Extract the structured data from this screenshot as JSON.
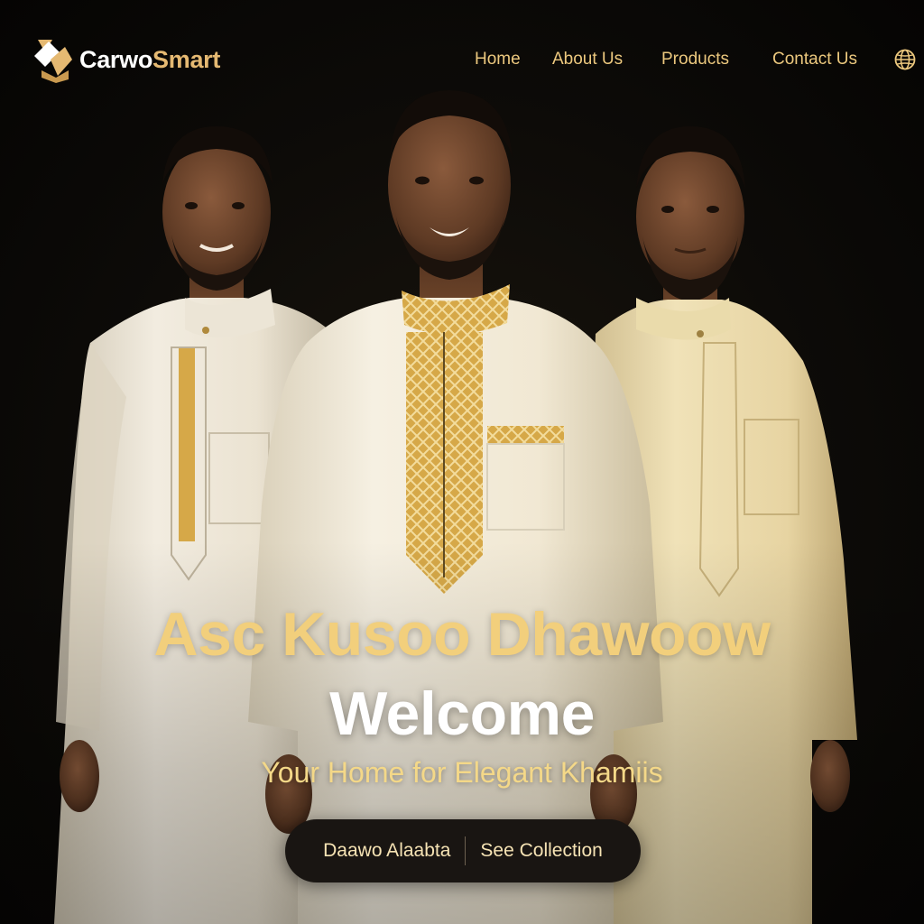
{
  "brand": {
    "name_part1": "Carwo",
    "name_part2": "Smart",
    "accent_color": "#e5b972"
  },
  "nav": {
    "items": [
      {
        "label": "Home"
      },
      {
        "label": "About Us"
      },
      {
        "label": "Products"
      },
      {
        "label": "Contact Us"
      }
    ],
    "language_icon": "globe-icon"
  },
  "hero": {
    "title_somali": "Asc Kusoo Dhawoow",
    "title_english": "Welcome",
    "subtitle": "Your Home for Elegant Khamiis",
    "buttons": [
      {
        "label": "Daawo Alaabta"
      },
      {
        "label": "See Collection"
      }
    ]
  },
  "colors": {
    "background": "#0d0b08",
    "gold_text": "#f2cf7c",
    "nav_text": "#ecc87e",
    "button_bg": "#191512",
    "robe_white": "#f1eadb",
    "robe_cream": "#efe1b6",
    "embroidery_gold": "#d9a94a"
  }
}
